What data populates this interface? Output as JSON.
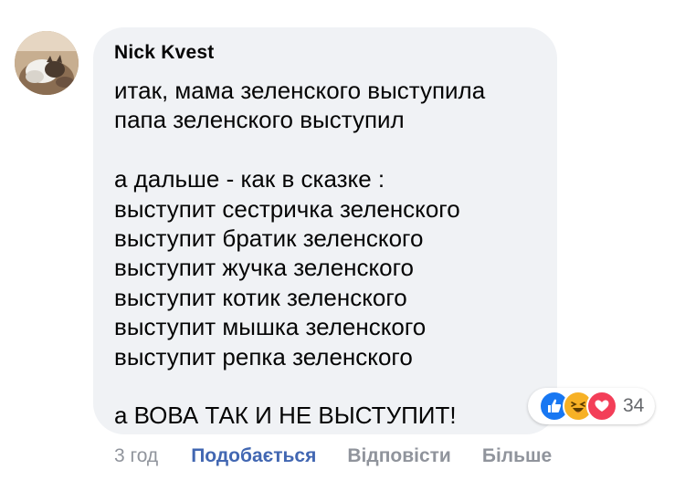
{
  "comment": {
    "author": "Nick Kvest",
    "lines": [
      "итак, мама зеленского выступила",
      "папа зеленского выступил",
      "",
      "а дальше - как в сказке :",
      "выступит сестричка зеленского",
      "выступит братик зеленского",
      "выступит жучка зеленского",
      "выступит котик зеленского",
      "выступит мышка зеленского",
      "выступит репка зеленского",
      "",
      "а ВОВА ТАК И НЕ ВЫСТУПИТ!"
    ]
  },
  "reactions": {
    "icons": [
      "like-icon",
      "haha-icon",
      "love-icon"
    ],
    "count": "34",
    "colors": {
      "like": "#1877f2",
      "haha": "#f7b125",
      "love": "#f33e58"
    }
  },
  "actions": {
    "time": "3 год",
    "like": "Подобається",
    "reply": "Відповісти",
    "more": "Більше"
  },
  "colors": {
    "bubble": "#f0f2f5",
    "link": "#4267b2",
    "muted": "#90949c"
  }
}
